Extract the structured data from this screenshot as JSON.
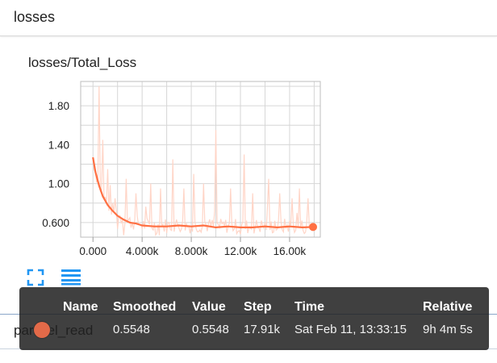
{
  "header": {
    "title": "losses"
  },
  "card": {
    "title": "losses/Total_Loss"
  },
  "toolbar": {
    "expand_icon": "fullscreen-icon",
    "data_icon": "list-lines-icon"
  },
  "colors": {
    "line": "#ff7043",
    "raw": "#ffd5c7",
    "grid": "#d6d6d6",
    "accent": "#2196f3"
  },
  "chart_data": {
    "type": "line",
    "title": "losses/Total_Loss",
    "xlim": [
      -1000,
      18500
    ],
    "ylim": [
      0.45,
      2.05
    ],
    "x_ticks": [
      0,
      4000,
      8000,
      12000,
      16000
    ],
    "x_tick_labels": [
      "0.000",
      "4.000k",
      "8.000k",
      "12.00k",
      "16.00k"
    ],
    "y_ticks": [
      0.6,
      1.0,
      1.4,
      1.8
    ],
    "y_tick_labels": [
      "0.600",
      "1.00",
      "1.40",
      "1.80"
    ],
    "grid": true,
    "series": [
      {
        "name": "parallel_read",
        "smoothed": [
          [
            0,
            1.27
          ],
          [
            200,
            1.12
          ],
          [
            500,
            0.98
          ],
          [
            800,
            0.87
          ],
          [
            1200,
            0.78
          ],
          [
            1600,
            0.72
          ],
          [
            2000,
            0.67
          ],
          [
            2500,
            0.63
          ],
          [
            3000,
            0.6
          ],
          [
            3500,
            0.59
          ],
          [
            4000,
            0.57
          ],
          [
            5000,
            0.56
          ],
          [
            6000,
            0.56
          ],
          [
            7000,
            0.57
          ],
          [
            8000,
            0.56
          ],
          [
            9000,
            0.57
          ],
          [
            10000,
            0.55
          ],
          [
            11000,
            0.56
          ],
          [
            12000,
            0.55
          ],
          [
            13000,
            0.55
          ],
          [
            14000,
            0.56
          ],
          [
            15000,
            0.55
          ],
          [
            16000,
            0.56
          ],
          [
            17000,
            0.55
          ],
          [
            17910,
            0.5548
          ]
        ],
        "raw_peaks": [
          [
            500,
            2.0
          ],
          [
            800,
            1.45
          ],
          [
            1200,
            1.15
          ],
          [
            1800,
            0.85
          ],
          [
            2700,
            1.05
          ],
          [
            3500,
            0.9
          ],
          [
            4700,
            1.0
          ],
          [
            5500,
            0.95
          ],
          [
            6500,
            1.25
          ],
          [
            7400,
            0.95
          ],
          [
            8200,
            1.1
          ],
          [
            9000,
            1.0
          ],
          [
            10000,
            1.55
          ],
          [
            11200,
            0.95
          ],
          [
            12300,
            1.3
          ],
          [
            13000,
            0.9
          ],
          [
            14300,
            1.05
          ],
          [
            15200,
            0.9
          ],
          [
            16200,
            0.85
          ],
          [
            16800,
            0.95
          ],
          [
            17500,
            0.85
          ]
        ]
      }
    ]
  },
  "tooltip": {
    "headers": {
      "name": "Name",
      "smoothed": "Smoothed",
      "value": "Value",
      "step": "Step",
      "time": "Time",
      "relative": "Relative"
    },
    "row": {
      "smoothed": "0.5548",
      "value": "0.5548",
      "step": "17.91k",
      "time": "Sat Feb 11, 13:33:15",
      "relative": "9h 4m 5s"
    }
  },
  "run": {
    "name": "parallel_read"
  }
}
